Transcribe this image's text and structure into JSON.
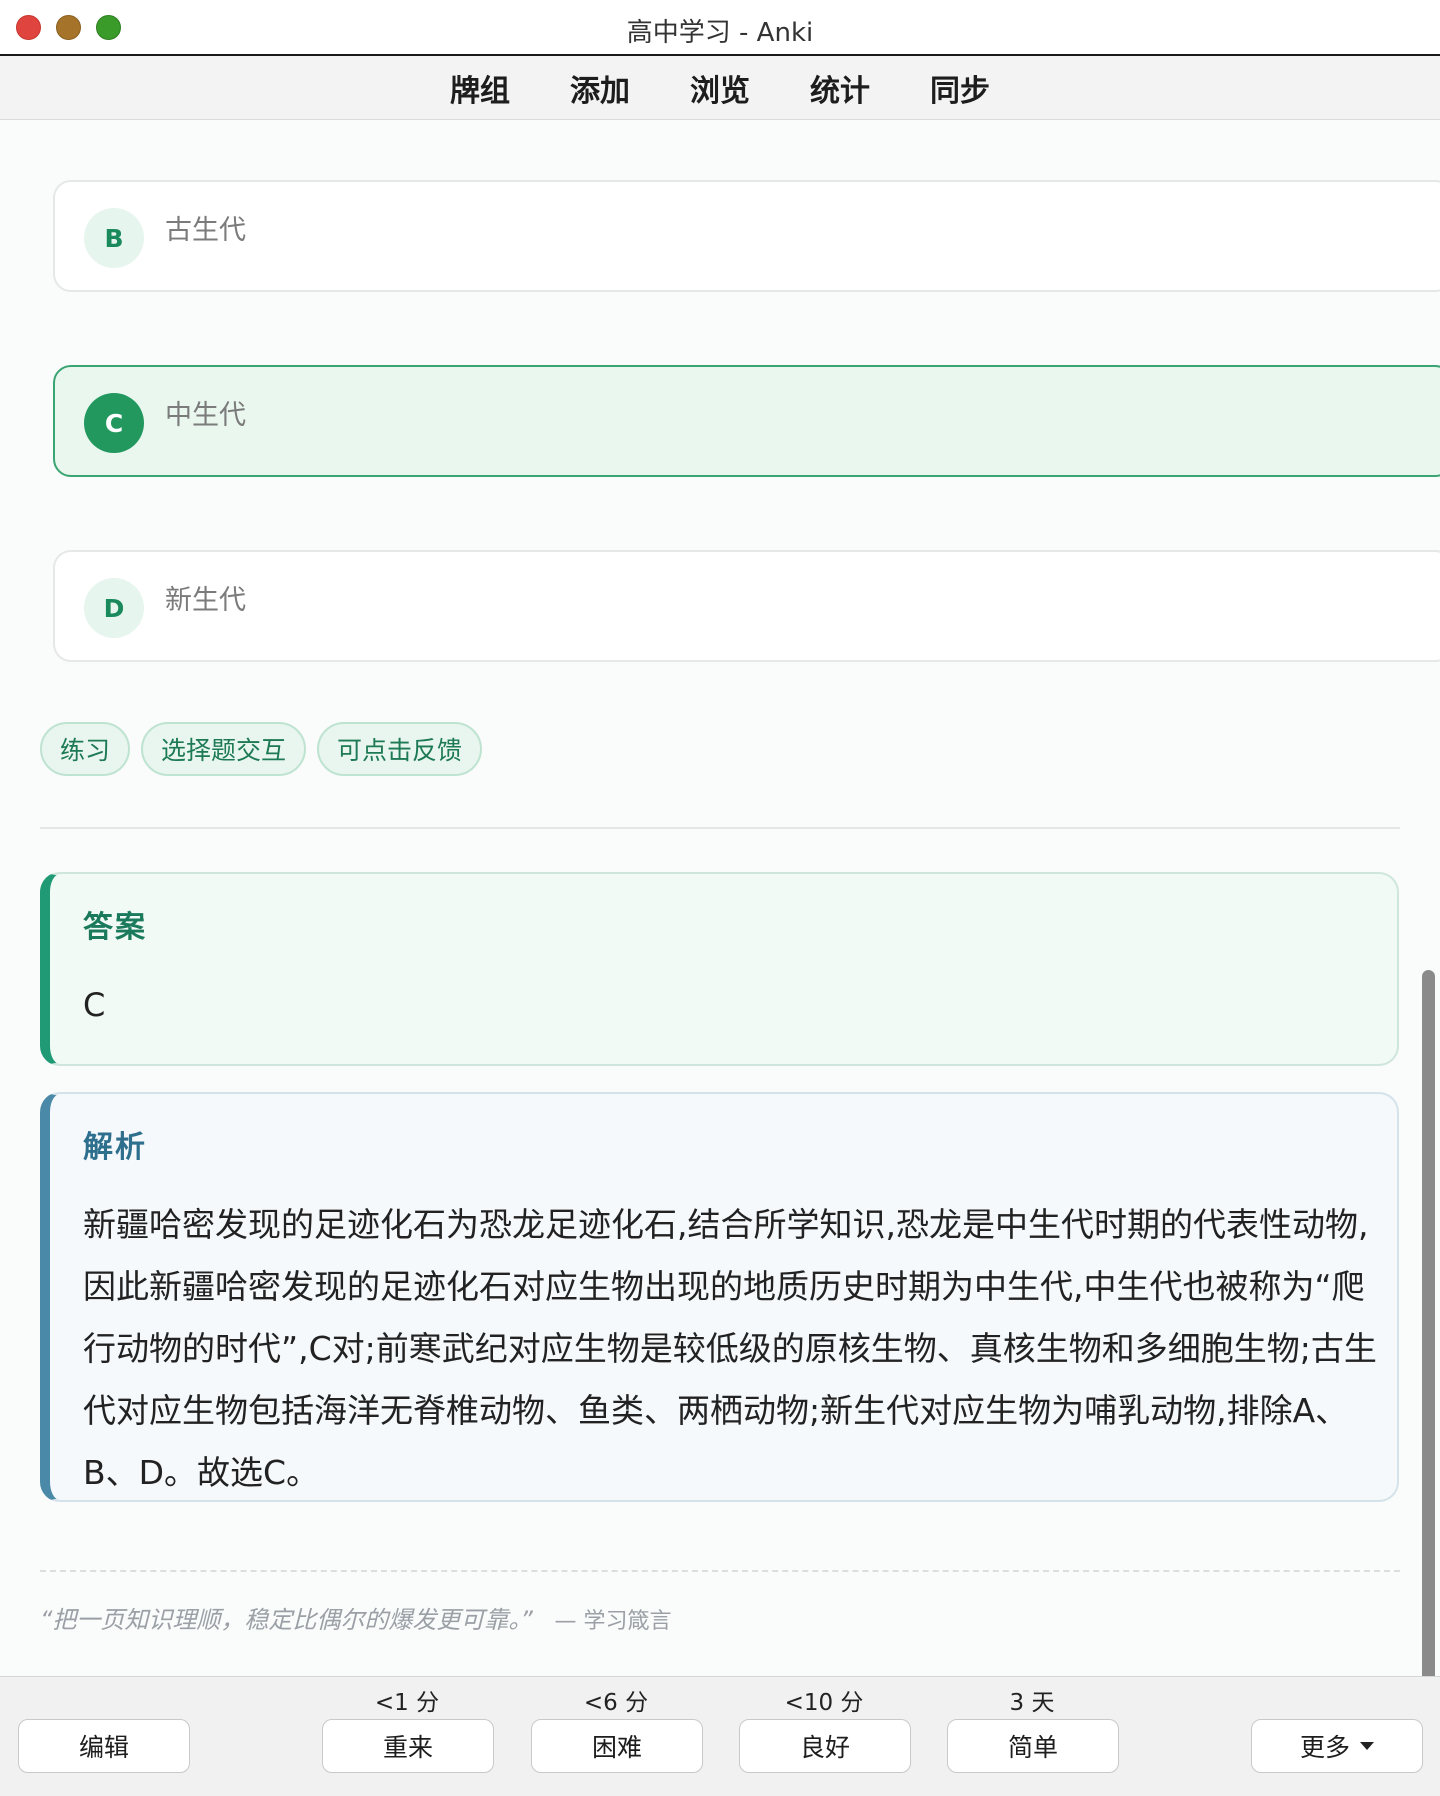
{
  "window": {
    "title": "高中学习 - Anki"
  },
  "toolbar": {
    "items": [
      "牌组",
      "添加",
      "浏览",
      "统计",
      "同步"
    ]
  },
  "options": [
    {
      "letter": "B",
      "text": "古生代",
      "state": "normal"
    },
    {
      "letter": "C",
      "text": "中生代",
      "state": "correct"
    },
    {
      "letter": "D",
      "text": "新生代",
      "state": "normal"
    }
  ],
  "tags": [
    "练习",
    "选择题交互",
    "可点击反馈"
  ],
  "answer": {
    "title": "答案",
    "value": "C"
  },
  "explanation": {
    "title": "解析",
    "text": "新疆哈密发现的足迹化石为恐龙足迹化石,结合所学知识,恐龙是中生代时期的代表性动物,因此新疆哈密发现的足迹化石对应生物出现的地质历史时期为中生代,中生代也被称为“爬行动物的时代”,C对;前寒武纪对应生物是较低级的原核生物、真核生物和多细胞生物;古生代对应生物包括海洋无脊椎动物、鱼类、两栖动物;新生代对应生物为哺乳动物,排除A、B、D。故选C。"
  },
  "quote": {
    "text": "“把一页知识理顺，稳定比偶尔的爆发更可靠。”",
    "source": "— 学习箴言"
  },
  "bottom": {
    "edit_label": "编辑",
    "more_label": "更多",
    "intervals": [
      "<1 分",
      "<6 分",
      "<10 分",
      "3 天"
    ],
    "answers": [
      "重来",
      "困难",
      "良好",
      "简单"
    ]
  },
  "colors": {
    "accent": "#22985f",
    "correct_bg": "#e9f7ef",
    "explain_accent": "#4a8aa8"
  }
}
